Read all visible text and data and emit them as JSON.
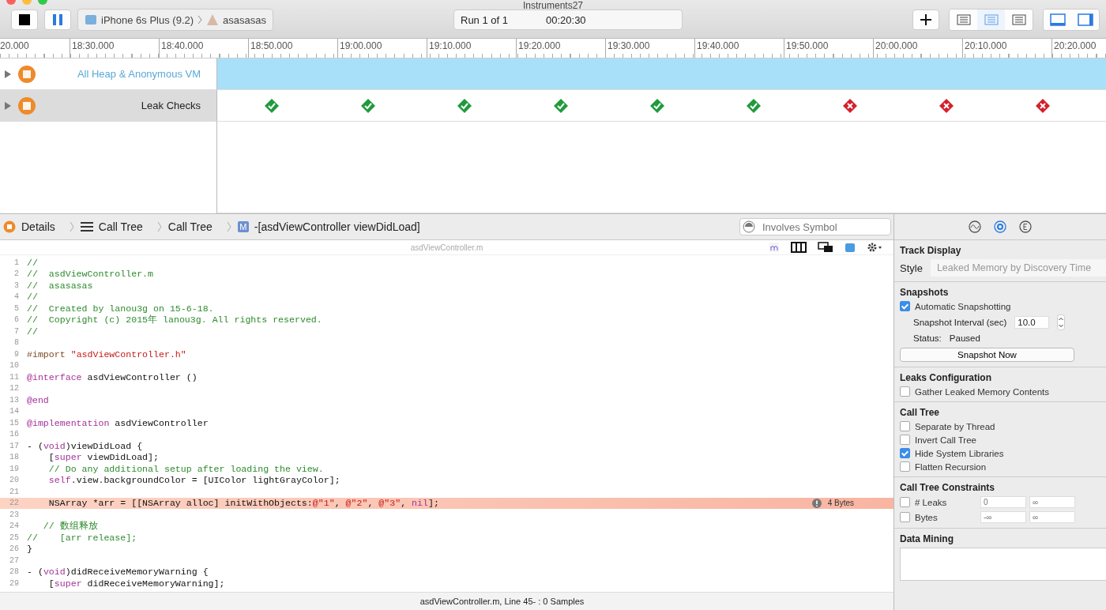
{
  "window": {
    "title": "Instruments27"
  },
  "toolbar": {
    "device": "iPhone 6s Plus (9.2)",
    "target": "asasasas",
    "run": "Run 1 of 1",
    "time": "00:20:30",
    "view_buttons": [
      {
        "selected": false
      },
      {
        "selected": true
      },
      {
        "selected": false
      }
    ],
    "panel_buttons": [
      {
        "selected": true
      },
      {
        "selected": true
      }
    ]
  },
  "ruler": [
    "20.000",
    "18:30.000",
    "18:40.000",
    "18:50.000",
    "19:00.000",
    "19:10.000",
    "19:20.000",
    "19:30.000",
    "19:40.000",
    "19:50.000",
    "20:00.000",
    "20:10.000",
    "20:20.000"
  ],
  "tracks": [
    {
      "name": "All Heap & Anonymous VM",
      "kind": "allocations",
      "selected": false
    },
    {
      "name": "Leak Checks",
      "kind": "leaks",
      "selected": true,
      "checks": [
        {
          "leaked": false
        },
        {
          "leaked": false
        },
        {
          "leaked": false
        },
        {
          "leaked": false
        },
        {
          "leaked": false
        },
        {
          "leaked": false
        },
        {
          "leaked": true
        },
        {
          "leaked": true
        },
        {
          "leaked": true
        }
      ]
    }
  ],
  "breadcrumbs": [
    {
      "label": "Details",
      "kind": "details"
    },
    {
      "label": "Call Tree",
      "kind": "list"
    },
    {
      "label": "Call Tree",
      "kind": "plain"
    },
    {
      "label": "-[asdViewController viewDidLoad]",
      "kind": "method",
      "badge": "M"
    }
  ],
  "search": {
    "placeholder": "Involves Symbol"
  },
  "editor": {
    "file": "asdViewController.m",
    "lines": [
      {
        "number": "1",
        "tokens": [
          {
            "kind": "comment",
            "text": "//"
          }
        ]
      },
      {
        "number": "2",
        "tokens": [
          {
            "kind": "comment",
            "text": "//  asdViewController.m"
          }
        ]
      },
      {
        "number": "3",
        "tokens": [
          {
            "kind": "comment",
            "text": "//  asasasas"
          }
        ]
      },
      {
        "number": "4",
        "tokens": [
          {
            "kind": "comment",
            "text": "//"
          }
        ]
      },
      {
        "number": "5",
        "tokens": [
          {
            "kind": "comment",
            "text": "//  Created by lanou3g on 15-6-18."
          }
        ]
      },
      {
        "number": "6",
        "tokens": [
          {
            "kind": "comment",
            "text": "//  Copyright (c) 2015年 lanou3g. All rights reserved."
          }
        ]
      },
      {
        "number": "7",
        "tokens": [
          {
            "kind": "comment",
            "text": "//"
          }
        ]
      },
      {
        "number": "8"
      },
      {
        "number": "9",
        "tokens": [
          {
            "kind": "preproc",
            "text": "#import "
          },
          {
            "kind": "string",
            "text": "\"asdViewController.h\""
          }
        ]
      },
      {
        "number": "10"
      },
      {
        "number": "11",
        "tokens": [
          {
            "kind": "keyword",
            "text": "@interface"
          },
          {
            "kind": "plain",
            "text": " asdViewController ()"
          }
        ]
      },
      {
        "number": "12"
      },
      {
        "number": "13",
        "tokens": [
          {
            "kind": "keyword",
            "text": "@end"
          }
        ]
      },
      {
        "number": "14"
      },
      {
        "number": "15",
        "tokens": [
          {
            "kind": "keyword",
            "text": "@implementation"
          },
          {
            "kind": "plain",
            "text": " asdViewController"
          }
        ]
      },
      {
        "number": "16"
      },
      {
        "number": "17",
        "tokens": [
          {
            "kind": "plain",
            "text": "- ("
          },
          {
            "kind": "keyword",
            "text": "void"
          },
          {
            "kind": "plain",
            "text": ")viewDidLoad {"
          }
        ]
      },
      {
        "number": "18",
        "tokens": [
          {
            "kind": "plain",
            "text": "    ["
          },
          {
            "kind": "keyword",
            "text": "super"
          },
          {
            "kind": "plain",
            "text": " viewDidLoad];"
          }
        ]
      },
      {
        "number": "19",
        "tokens": [
          {
            "kind": "comment",
            "text": "    // Do any additional setup after loading the view."
          }
        ]
      },
      {
        "number": "20",
        "tokens": [
          {
            "kind": "keyword",
            "text": "    self"
          },
          {
            "kind": "plain",
            "text": ".view.backgroundColor = [UIColor lightGrayColor];"
          }
        ]
      },
      {
        "number": "21"
      },
      {
        "number": "22",
        "highlighted": true,
        "annotation": "4 Bytes",
        "tokens": [
          {
            "kind": "plain",
            "text": "    NSArray *arr = [[NSArray alloc] initWithObjects:"
          },
          {
            "kind": "string",
            "text": "@\"1\""
          },
          {
            "kind": "plain",
            "text": ", "
          },
          {
            "kind": "string",
            "text": "@\"2\""
          },
          {
            "kind": "plain",
            "text": ", "
          },
          {
            "kind": "string",
            "text": "@\"3\""
          },
          {
            "kind": "plain",
            "text": ", "
          },
          {
            "kind": "keyword",
            "text": "nil"
          },
          {
            "kind": "plain",
            "text": "];"
          }
        ]
      },
      {
        "number": "23"
      },
      {
        "number": "24",
        "tokens": [
          {
            "kind": "comment",
            "text": "   // 数组释放"
          }
        ]
      },
      {
        "number": "25",
        "tokens": [
          {
            "kind": "comment",
            "text": "//    [arr release];"
          }
        ]
      },
      {
        "number": "26",
        "tokens": [
          {
            "kind": "plain",
            "text": "}"
          }
        ]
      },
      {
        "number": "27"
      },
      {
        "number": "28",
        "tokens": [
          {
            "kind": "plain",
            "text": "- ("
          },
          {
            "kind": "keyword",
            "text": "void"
          },
          {
            "kind": "plain",
            "text": ")didReceiveMemoryWarning {"
          }
        ]
      },
      {
        "number": "29",
        "tokens": [
          {
            "kind": "plain",
            "text": "    ["
          },
          {
            "kind": "keyword",
            "text": "super"
          },
          {
            "kind": "plain",
            "text": " didReceiveMemoryWarning];"
          }
        ]
      }
    ],
    "status": "asdViewController.m, Line 45- : 0 Samples"
  },
  "inspector": {
    "tabs": [
      {
        "kind": "wave",
        "selected": false
      },
      {
        "kind": "gear",
        "selected": true
      },
      {
        "kind": "info",
        "selected": false
      }
    ],
    "track_display": {
      "title": "Track Display",
      "style_label": "Style",
      "style_value": "Leaked Memory by Discovery Time"
    },
    "snapshots": {
      "title": "Snapshots",
      "auto": {
        "label": "Automatic Snapshotting",
        "checked": true
      },
      "interval_label": "Snapshot Interval (sec)",
      "interval": "10.0",
      "status_label": "Status:",
      "status": "Paused",
      "button": "Snapshot Now"
    },
    "leaks_configuration": {
      "title": "Leaks Configuration",
      "options": [
        {
          "label": "Gather Leaked Memory Contents",
          "checked": false
        }
      ]
    },
    "call_tree": {
      "title": "Call Tree",
      "options": [
        {
          "label": "Separate by Thread",
          "checked": false
        },
        {
          "label": "Invert Call Tree",
          "checked": false
        },
        {
          "label": "Hide System Libraries",
          "checked": true
        },
        {
          "label": "Flatten Recursion",
          "checked": false
        }
      ]
    },
    "constraints": {
      "title": "Call Tree Constraints",
      "rows": [
        {
          "label": "# Leaks",
          "checked": false,
          "min": {
            "placeholder": "0"
          },
          "max": {
            "placeholder": "∞"
          }
        },
        {
          "label": "Bytes",
          "checked": false,
          "min": {
            "placeholder": "-∞"
          },
          "max": {
            "placeholder": "∞"
          }
        }
      ]
    },
    "data_mining": {
      "title": "Data Mining"
    }
  }
}
